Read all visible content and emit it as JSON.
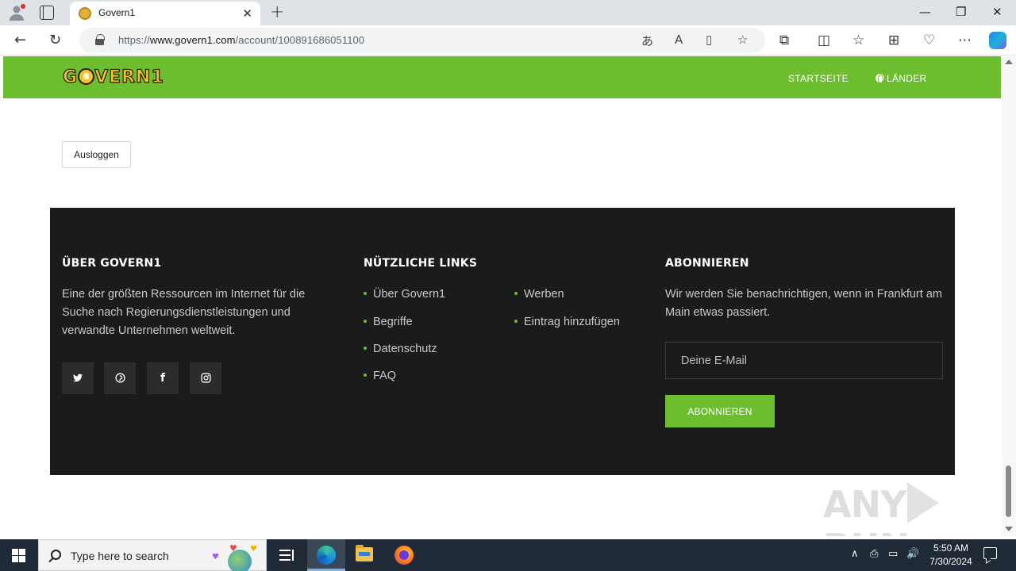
{
  "browser": {
    "tab_title": "Govern1",
    "url_scheme": "https://",
    "url_domain": "www.govern1.com",
    "url_path": "/account/100891686051100"
  },
  "site": {
    "logo_text_1": "G",
    "logo_text_2": "VERN1",
    "nav": {
      "home": "STARTSEITE",
      "countries": "LÄNDER"
    },
    "logout_label": "Ausloggen"
  },
  "footer": {
    "about": {
      "heading": "ÜBER GOVERN1",
      "text": "Eine der größten Ressourcen im Internet für die Suche nach Regierungsdienstleistungen und verwandte Unternehmen weltweit."
    },
    "links": {
      "heading": "NÜTZLICHE LINKS",
      "col1": [
        "Über Govern1",
        "Begriffe",
        "Datenschutz",
        "FAQ"
      ],
      "col2": [
        "Werben",
        "Eintrag hinzufügen"
      ]
    },
    "subscribe": {
      "heading": "ABONNIEREN",
      "text": "Wir werden Sie benachrichtigen, wenn in Frankfurt am Main etwas passiert.",
      "placeholder": "Deine E-Mail",
      "button": "ABONNIEREN"
    },
    "social_icons": [
      "twitter-icon",
      "pinterest-icon",
      "facebook-icon",
      "instagram-icon"
    ]
  },
  "watermark": {
    "left": "ANY",
    "right": "RUN"
  },
  "taskbar": {
    "search_placeholder": "Type here to search",
    "time": "5:50 AM",
    "date": "7/30/2024"
  },
  "colors": {
    "brand_green": "#6dbe2f",
    "footer_bg": "#1b1b1b"
  }
}
